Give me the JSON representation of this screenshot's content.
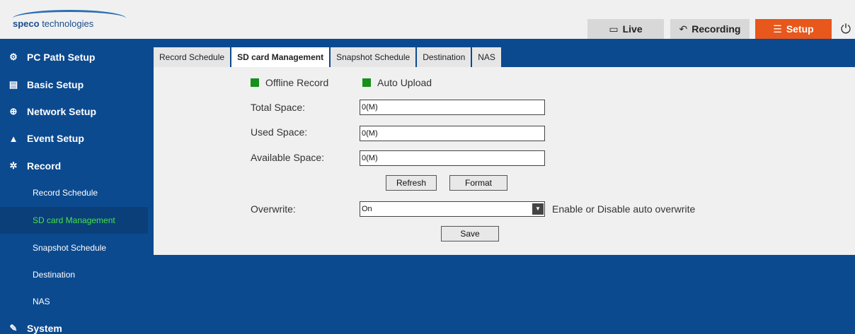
{
  "header": {
    "brand_bold": "speco",
    "brand_rest": " technologies",
    "buttons": [
      {
        "label": "Live",
        "icon": "monitor-icon"
      },
      {
        "label": "Recording",
        "icon": "undo-icon"
      },
      {
        "label": "Setup",
        "icon": "list-icon"
      }
    ],
    "power_icon": "power-icon",
    "setup_color": "#e8571b"
  },
  "sidebar": {
    "items": [
      {
        "label": "PC Path Setup",
        "icon": "gear-icon"
      },
      {
        "label": "Basic Setup",
        "icon": "clapperboard-icon"
      },
      {
        "label": "Network Setup",
        "icon": "globe-icon"
      },
      {
        "label": "Event Setup",
        "icon": "alarm-bell-icon"
      },
      {
        "label": "Record",
        "icon": "film-reel-icon"
      }
    ],
    "record_sub": [
      {
        "label": "Record Schedule",
        "active": false
      },
      {
        "label": "SD card Management",
        "active": true
      },
      {
        "label": "Snapshot Schedule",
        "active": false
      },
      {
        "label": "Destination",
        "active": false
      },
      {
        "label": "NAS",
        "active": false
      }
    ],
    "system": {
      "label": "System",
      "icon": "wrench-icon"
    },
    "colors": {
      "background": "#0c4a8f",
      "active_text": "#46e346"
    }
  },
  "tabs": [
    {
      "label": "Record Schedule",
      "active": false
    },
    {
      "label": "SD card Management",
      "active": true
    },
    {
      "label": "Snapshot Schedule",
      "active": false
    },
    {
      "label": "Destination",
      "active": false
    },
    {
      "label": "NAS",
      "active": false
    }
  ],
  "form": {
    "offline_record": {
      "label": "Offline Record",
      "checked": true
    },
    "auto_upload": {
      "label": "Auto Upload",
      "checked": true
    },
    "total_space": {
      "label": "Total Space:",
      "value": "0(M)"
    },
    "used_space": {
      "label": "Used Space:",
      "value": "0(M)"
    },
    "available_space": {
      "label": "Available Space:",
      "value": "0(M)"
    },
    "refresh_label": "Refresh",
    "format_label": "Format",
    "overwrite": {
      "label": "Overwrite:",
      "value": "On",
      "hint": "Enable or Disable auto overwrite"
    },
    "save_label": "Save"
  }
}
